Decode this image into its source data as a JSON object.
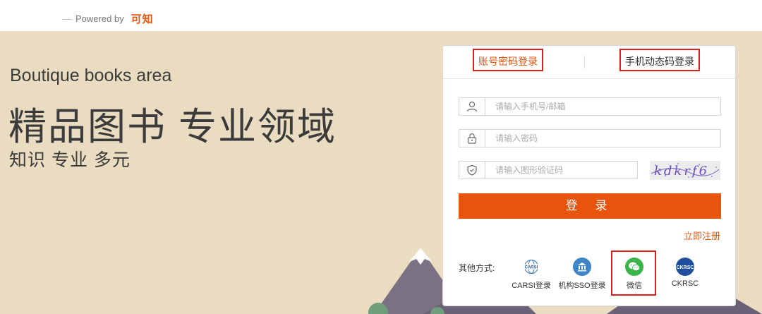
{
  "header": {
    "powered_prefix": "Powered by",
    "brand": "可知"
  },
  "hero": {
    "en_title": "Boutique books area",
    "cn_title": "精品图书  专业领域",
    "cn_sub": "知识  专业  多元"
  },
  "login": {
    "tabs": [
      {
        "label": "账号密码登录",
        "active": true
      },
      {
        "label": "手机动态码登录",
        "active": false
      }
    ],
    "username_placeholder": "请输入手机号/邮箱",
    "password_placeholder": "请输入密码",
    "captcha_placeholder": "请输入图形验证码",
    "captcha_text": "kdkrf6",
    "submit_label": "登 录",
    "register_link": "立即注册",
    "other_methods_label": "其他方式:",
    "methods": [
      {
        "label": "CARSI登录",
        "icon": "carsi-icon"
      },
      {
        "label": "机构SSO登录",
        "icon": "institution-icon"
      },
      {
        "label": "微信",
        "icon": "wechat-icon"
      },
      {
        "label": "CKRSC",
        "icon": "ckrsc-icon"
      }
    ]
  },
  "colors": {
    "accent": "#e8540c",
    "highlight_frame": "#e02020",
    "hero_bg": "#e9dcc0"
  }
}
